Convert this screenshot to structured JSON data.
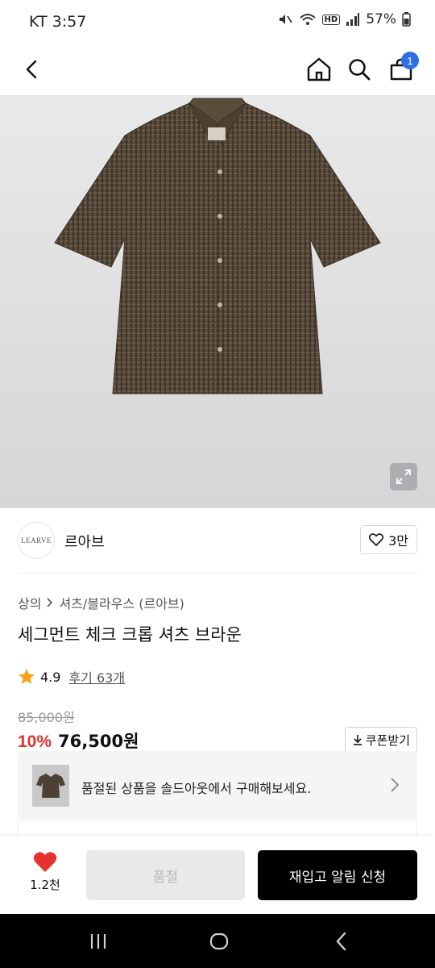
{
  "status_bar": {
    "time": "KT 3:57",
    "battery": "57%",
    "hd": "HD"
  },
  "header": {
    "cart_count": "1"
  },
  "brand": {
    "logo_text": "LEARVE",
    "name": "르아브",
    "likes": "3만"
  },
  "breadcrumb": {
    "category": "상의",
    "subcategory": "셔츠/블라우스 (르아브)"
  },
  "product": {
    "title": "세그먼트 체크 크롭 셔츠 브라운",
    "rating": "4.9",
    "reviews": "후기 63개",
    "original_price": "85,000원",
    "discount": "10%",
    "price": "76,500원",
    "coupon_label": "쿠폰받기"
  },
  "soldout_banner": {
    "text": "품절된 상품을 솔드아웃에서 구매해보세요."
  },
  "bottom_bar": {
    "wish_count": "1.2천",
    "soldout_label": "품절",
    "restock_label": "재입고 알림 신청"
  },
  "colors": {
    "accent_red": "#e5322d",
    "badge_blue": "#2f6fe4",
    "star": "#f4a51c"
  }
}
